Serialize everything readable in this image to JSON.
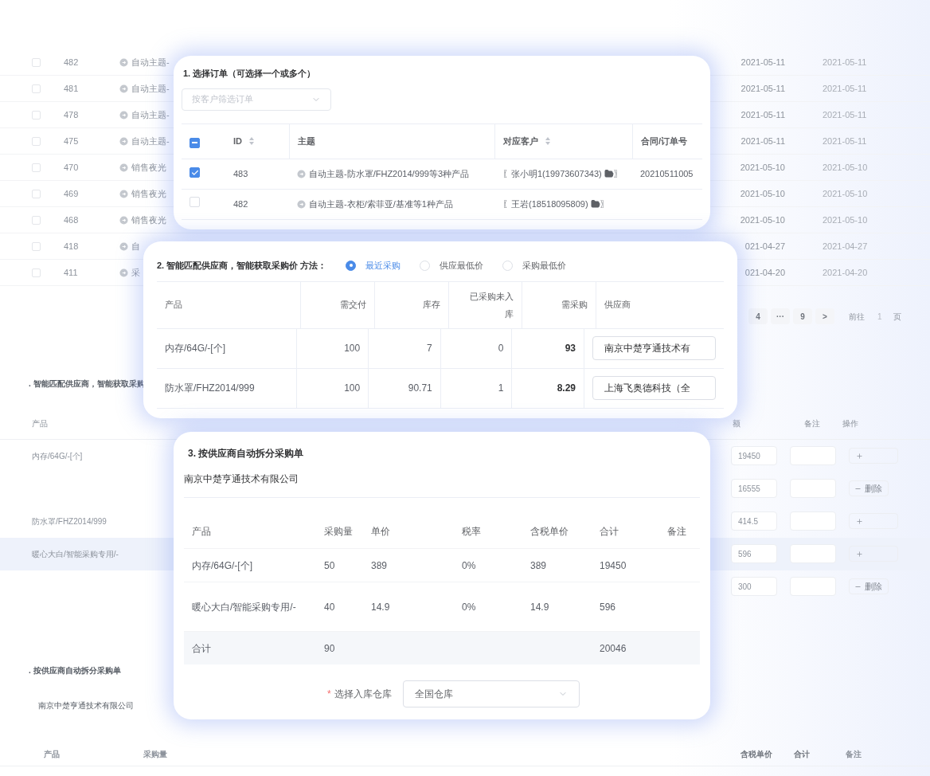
{
  "background": {
    "orders": [
      {
        "checked": false,
        "id": "482",
        "subject": "自动主题-",
        "date_1": "2021-05-11",
        "date_2": "2021-05-11"
      },
      {
        "checked": false,
        "id": "481",
        "subject": "自动主题-",
        "date_1": "2021-05-11",
        "date_2": "2021-05-11"
      },
      {
        "checked": false,
        "id": "478",
        "subject": "自动主题-",
        "date_1": "2021-05-11",
        "date_2": "2021-05-11"
      },
      {
        "checked": false,
        "id": "475",
        "subject": "自动主题-",
        "date_1": "2021-05-11",
        "date_2": "2021-05-11"
      },
      {
        "checked": false,
        "id": "470",
        "subject": "销售夜光",
        "date_1": "2021-05-10",
        "date_2": "2021-05-10"
      },
      {
        "checked": false,
        "id": "469",
        "subject": "销售夜光",
        "date_1": "2021-05-10",
        "date_2": "2021-05-10"
      },
      {
        "checked": false,
        "id": "468",
        "subject": "销售夜光",
        "date_1": "2021-05-10",
        "date_2": "2021-05-10"
      },
      {
        "checked": false,
        "id": "418",
        "subject": "自",
        "date_1": "021-04-27",
        "date_2": "2021-04-27"
      },
      {
        "checked": false,
        "id": "411",
        "subject": "采",
        "date_1": "021-04-20",
        "date_2": "2021-04-20"
      }
    ],
    "pagination": [
      "4",
      "···",
      "9",
      ">"
    ],
    "goto_label": "前往",
    "goto_value": "1",
    "goto_unit": "页",
    "section_2": {
      "title": ". 智能匹配供应商，智能获取采购",
      "columns": [
        "产品",
        "额",
        "备注",
        "操作"
      ],
      "rows": [
        {
          "product": "内存/64G/-[个]",
          "amount": "19450",
          "action": {
            "kind": "add"
          },
          "highlighted": false
        },
        {
          "amount": "16555",
          "action": {
            "kind": "delete",
            "label": "删除"
          },
          "highlighted": false
        },
        {
          "product": "防水罩/FHZ2014/999",
          "amount": "414.5",
          "action": {
            "kind": "add"
          },
          "highlighted": false
        },
        {
          "product": "暖心大白/智能采购专用/-",
          "amount": "596",
          "action": {
            "kind": "add"
          },
          "highlighted": true
        },
        {
          "amount": "300",
          "action": {
            "kind": "delete",
            "label": "删除"
          },
          "highlighted": false
        }
      ]
    },
    "section_3": {
      "title": ". 按供应商自动拆分采购单",
      "supplier": "南京中楚亨通技术有限公司",
      "columns": [
        "产品",
        "采购量",
        "含税单价",
        "合计",
        "备注"
      ]
    }
  },
  "order_card": {
    "title": "1. 选择订单（可选择一个或多个）",
    "filter_placeholder": "按客户筛选订单",
    "select_all_partial": true,
    "columns": [
      {
        "label": "ID",
        "sortable": true
      },
      {
        "label": "主题",
        "sortable": false
      },
      {
        "label": "对应客户",
        "sortable": true
      },
      {
        "label": "合同/订单号",
        "sortable": false
      }
    ],
    "rows": [
      {
        "checked": true,
        "id": "483",
        "subject": "自动主题-防水罩/FHZ2014/999等3种产品",
        "customer": "〖张小明1(19973607343)",
        "customer_end": "〗",
        "contract": "20210511005"
      },
      {
        "checked": false,
        "id": "482",
        "subject": "自动主题-衣柜/索菲亚/基准等1种产品",
        "customer": "〖王岩(18518095809)",
        "customer_end": "〗"
      }
    ]
  },
  "supplier_card": {
    "title": "2. 智能匹配供应商，智能获取采购价 方法：",
    "methods": [
      {
        "label": "最近采购",
        "selected": true
      },
      {
        "label": "供应最低价",
        "selected": false
      },
      {
        "label": "采购最低价",
        "selected": false
      }
    ],
    "columns": [
      "产品",
      "需交付",
      "库存",
      "已采购未入库",
      "需采购",
      "供应商"
    ],
    "rows": [
      {
        "product": "内存/64G/-[个]",
        "deliver": "100",
        "stock": "7",
        "pending": "0",
        "need": "93",
        "supplier": "南京中楚亨通技术有"
      },
      {
        "product": "防水罩/FHZ2014/999",
        "deliver": "100",
        "stock": "90.71",
        "pending": "1",
        "need": "8.29",
        "supplier": "上海飞奥德科技（全"
      }
    ]
  },
  "split_card": {
    "title": "3. 按供应商自动拆分采购单",
    "supplier": "南京中楚亨通技术有限公司",
    "columns": [
      "产品",
      "采购量",
      "单价",
      "税率",
      "含税单价",
      "合计",
      "备注"
    ],
    "rows": [
      [
        "内存/64G/-[个]",
        "50",
        "389",
        "0%",
        "389",
        "19450"
      ],
      [
        "暖心大白/智能采购专用/-",
        "40",
        "14.9",
        "0%",
        "14.9",
        "596"
      ]
    ],
    "total": {
      "label": "合计",
      "quantity": "90",
      "sum": "20046"
    },
    "warehouse_label": "选择入库仓库",
    "required_mark": "*",
    "warehouse": "全国仓库"
  }
}
